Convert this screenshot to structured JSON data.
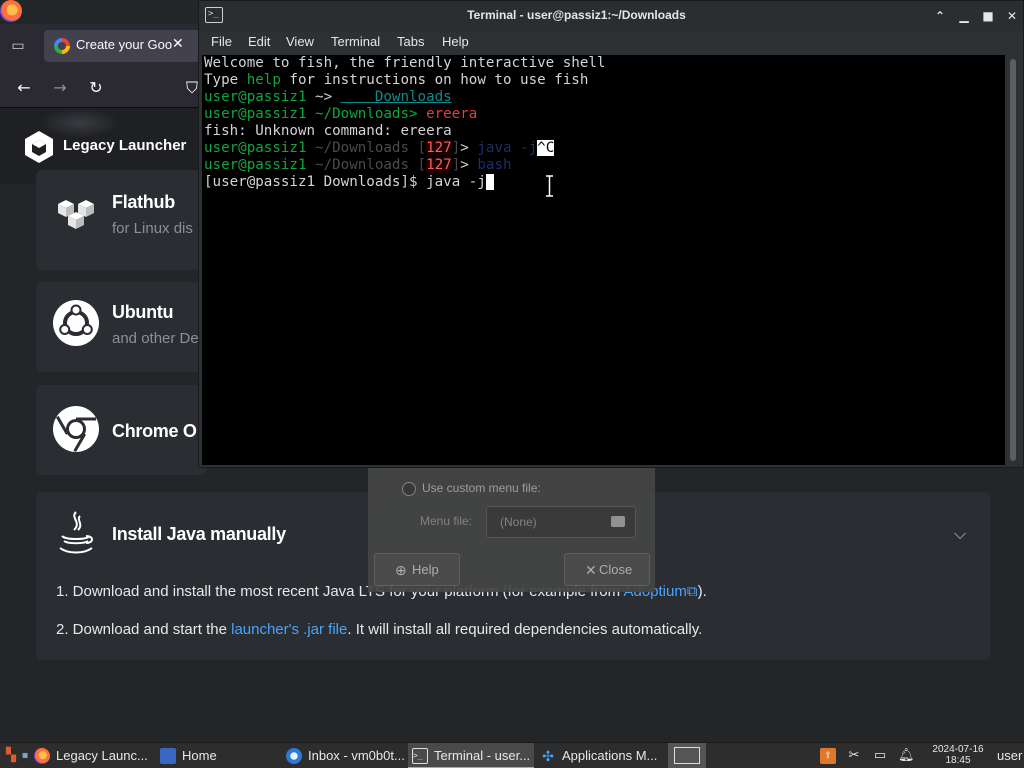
{
  "browser": {
    "tab_title": "Create your Goo",
    "tab_close": "✕",
    "site_name": "Legacy Launcher"
  },
  "cards": [
    {
      "title": "Flathub",
      "subtitle": "for Linux dis",
      "icon": "flathub-icon"
    },
    {
      "title": "Ubuntu",
      "subtitle": "and other De",
      "icon": "ubuntu-icon"
    },
    {
      "title": "Chrome O",
      "subtitle": "",
      "icon": "chrome-icon"
    }
  ],
  "java": {
    "title": "Install Java manually",
    "step1_pre": "1. Download and install the most recent Java LTS for your platform (for example from ",
    "step1_link": "Adoptium",
    "step1_post": ").",
    "step2_pre": "2. Download and start the ",
    "step2_link": "launcher's .jar file",
    "step2_post": ". It will install all required dependencies automatically."
  },
  "dialog": {
    "radio_label": "Use custom menu file:",
    "menu_file_label": "Menu file:",
    "menu_file_value": "(None)",
    "help_label": "Help",
    "close_label": "Close"
  },
  "terminal": {
    "title": "Terminal - user@passiz1:~/Downloads",
    "menu": [
      "File",
      "Edit",
      "View",
      "Terminal",
      "Tabs",
      "Help"
    ],
    "lines": {
      "l1": "Welcome to fish, the friendly interactive shell",
      "l2_a": "Type ",
      "l2_b": "help",
      "l2_c": " for instructions on how to use fish",
      "l3_user": "user@passiz1",
      "l3_path": " ~> ",
      "l3_cmd": "    Downloads",
      "l4_user": "user@passiz1",
      "l4_path": " ~/Downloads> ",
      "l4_cmd": "ereera",
      "l5": "fish: Unknown command: ereera",
      "l6_user": "user@passiz1",
      "l6_path": " ~/Downloads ",
      "l6_bracket_l": "[",
      "l6_status": "127",
      "l6_bracket_r": "]",
      "l6_prompt": "> ",
      "l6_cmd": "java -j",
      "l6_ctrl": "^C",
      "l7_user": "user@passiz1",
      "l7_path": " ~/Downloads ",
      "l7_bracket_l": "[",
      "l7_status": "127",
      "l7_bracket_r": "]",
      "l7_prompt": "> ",
      "l7_cmd": "bash",
      "l8": "[user@passiz1 Downloads]$ java -j"
    }
  },
  "taskbar": {
    "items": [
      {
        "label": "Legacy Launc...",
        "icon": "firefox-icon"
      },
      {
        "label": "Home",
        "icon": "file-manager-icon"
      },
      {
        "label": "Inbox - vm0b0t...",
        "icon": "thunderbird-icon"
      },
      {
        "label": "Terminal - user...",
        "icon": "terminal-icon"
      },
      {
        "label": "Applications M...",
        "icon": "settings-icon"
      }
    ],
    "clock_date": "2024-07-16",
    "clock_time": "18:45",
    "user": "user"
  }
}
